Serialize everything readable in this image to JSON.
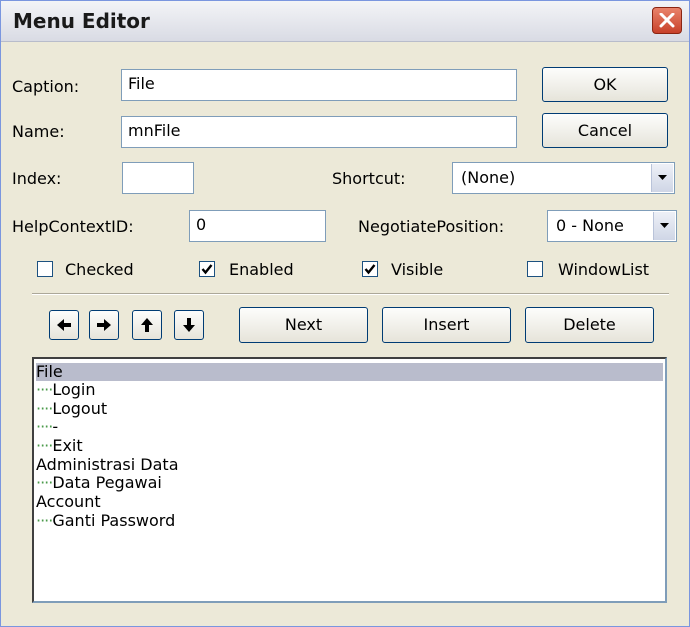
{
  "window": {
    "title": "Menu Editor"
  },
  "form": {
    "caption_label": "Caption:",
    "caption_value": "File",
    "name_label": "Name:",
    "name_value": "mnFile",
    "index_label": "Index:",
    "index_value": "",
    "shortcut_label": "Shortcut:",
    "shortcut_value": "(None)",
    "helpcontext_label": "HelpContextID:",
    "helpcontext_value": "0",
    "negotiate_label": "NegotiatePosition:",
    "negotiate_value": "0 - None"
  },
  "checkboxes": {
    "checked": {
      "label": "Checked",
      "state": false
    },
    "enabled": {
      "label": "Enabled",
      "state": true
    },
    "visible": {
      "label": "Visible",
      "state": true
    },
    "windowlist": {
      "label": "WindowList",
      "state": false
    }
  },
  "buttons": {
    "ok": "OK",
    "cancel": "Cancel",
    "next": "Next",
    "insert": "Insert",
    "delete": "Delete"
  },
  "menu_items": [
    {
      "dots": "",
      "text": "File",
      "selected": true
    },
    {
      "dots": "····",
      "text": "Login"
    },
    {
      "dots": "····",
      "text": "Logout"
    },
    {
      "dots": "····",
      "text": "-"
    },
    {
      "dots": "····",
      "text": "Exit"
    },
    {
      "dots": "",
      "text": "Administrasi Data"
    },
    {
      "dots": "····",
      "text": "Data Pegawai"
    },
    {
      "dots": "",
      "text": "Account"
    },
    {
      "dots": "····",
      "text": "Ganti Password"
    }
  ],
  "colors": {
    "title_bar": "#e3e5ec",
    "close_button": "#d9573c",
    "dialog_bg": "#ece9d8",
    "selection": "#b9bccc",
    "tree_dots": "#4a9a4a"
  }
}
